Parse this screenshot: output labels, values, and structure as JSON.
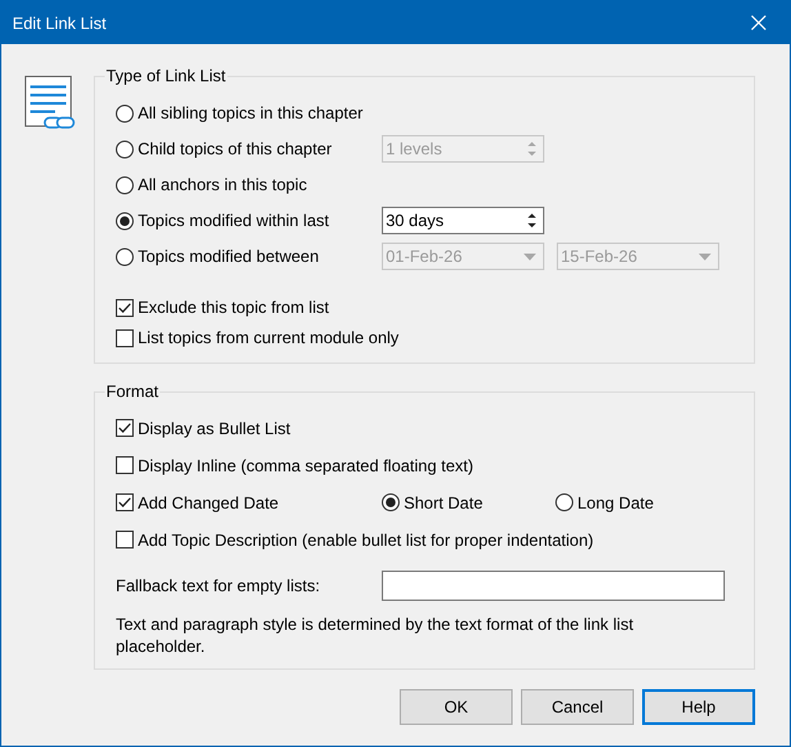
{
  "window": {
    "title": "Edit Link List"
  },
  "type_group": {
    "title": "Type of Link List",
    "options": [
      {
        "label": "All sibling topics in this chapter",
        "selected": false
      },
      {
        "label": "Child topics of this chapter",
        "selected": false,
        "spin": {
          "value": "1 levels",
          "disabled": true
        }
      },
      {
        "label": "All anchors in this topic",
        "selected": false
      },
      {
        "label": "Topics modified within last",
        "selected": true,
        "spin": {
          "value": "30 days",
          "disabled": false
        }
      },
      {
        "label": "Topics modified between",
        "selected": false,
        "dates": [
          {
            "value": "01-Feb-26",
            "disabled": true
          },
          {
            "value": "15-Feb-26",
            "disabled": true
          }
        ]
      }
    ],
    "checkboxes": [
      {
        "label": "Exclude this topic from list",
        "checked": true
      },
      {
        "label": "List topics from current module only",
        "checked": false
      }
    ]
  },
  "format_group": {
    "title": "Format",
    "items": [
      {
        "label": "Display as Bullet List",
        "checked": true
      },
      {
        "label": "Display Inline (comma separated floating text)",
        "checked": false
      },
      {
        "label": "Add Changed Date",
        "checked": true,
        "radios": [
          {
            "label": "Short Date",
            "selected": true
          },
          {
            "label": "Long Date",
            "selected": false
          }
        ]
      },
      {
        "label": "Add Topic Description (enable bullet list for proper indentation)",
        "checked": false
      }
    ],
    "fallback": {
      "label": "Fallback text for empty lists:"
    },
    "note": "Text and paragraph style is determined by the text format of the link list placeholder."
  },
  "buttons": [
    {
      "label": "OK",
      "focused": false
    },
    {
      "label": "Cancel",
      "focused": false
    },
    {
      "label": "Help",
      "focused": true
    }
  ]
}
